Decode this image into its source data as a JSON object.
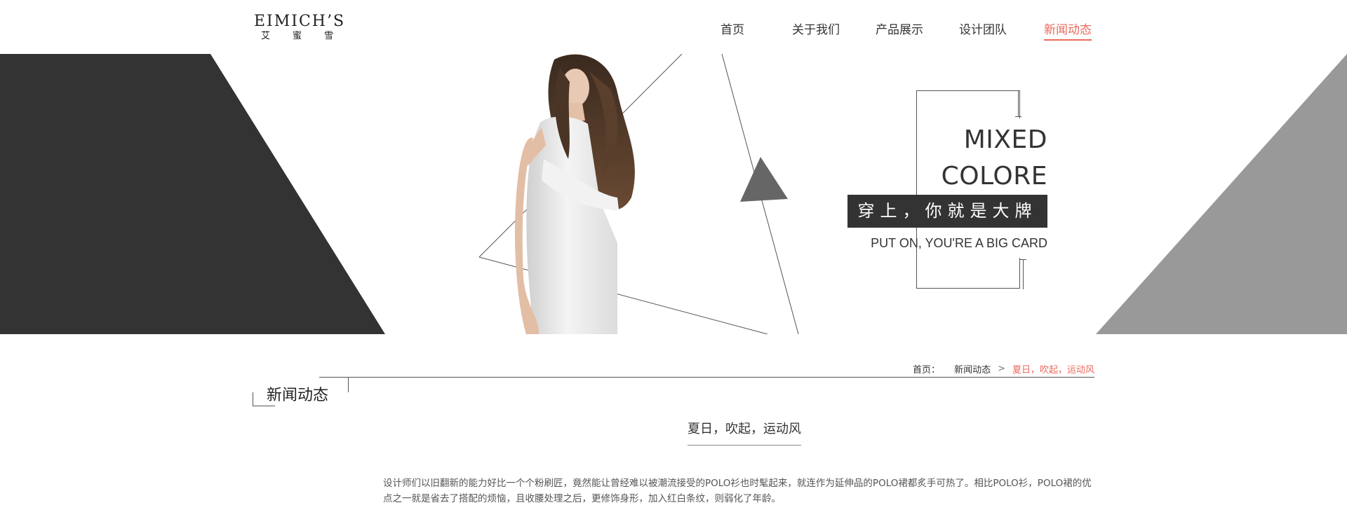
{
  "brand": {
    "name_en": "EIMICH’S",
    "name_cn": [
      "艾",
      "蜜",
      "雪"
    ]
  },
  "nav": {
    "items": [
      {
        "label": "首页"
      },
      {
        "label": "关于我们"
      },
      {
        "label": "产品展示"
      },
      {
        "label": "设计团队"
      },
      {
        "label": "新闻动态",
        "active": true
      }
    ]
  },
  "banner": {
    "headline_line1": "MIXED",
    "headline_line2": "COLORE",
    "slogan_cn": "穿上，你就是大牌",
    "slogan_en": "PUT ON, YOU'RE A BIG CARD",
    "colors": {
      "dark_shape": "#333333",
      "light_shape": "#999999",
      "triangle": "#666666"
    }
  },
  "breadcrumb": {
    "home": "首页：",
    "section": "新闻动态",
    "separator": ">",
    "current": "夏日，吹起，运动风"
  },
  "section": {
    "title": "新闻动态"
  },
  "article": {
    "title": "夏日，吹起，运动风",
    "body": "设计师们以旧翻新的能力好比一个个粉刷匠，竟然能让曾经难以被潮流接受的POLO衫也时髦起来，就连作为延伸品的POLO裙都炙手可热了。相比POLO衫，POLO裙的优点之一就是省去了搭配的烦恼，且收腰处理之后，更修饰身形，加入红白条纹，则弱化了年龄。"
  },
  "theme": {
    "accent": "#ec6a5c",
    "text": "#333333"
  }
}
